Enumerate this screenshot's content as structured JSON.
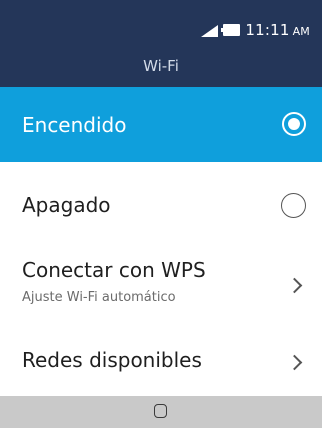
{
  "status_bar": {
    "time": "11:11",
    "ampm": "AM",
    "signal_icon": "signal-icon",
    "battery_icon": "battery-icon"
  },
  "header": {
    "title": "Wi-Fi"
  },
  "options": {
    "on": {
      "label": "Encendido",
      "selected": true
    },
    "off": {
      "label": "Apagado",
      "selected": false
    }
  },
  "items": {
    "wps": {
      "label": "Conectar con WPS",
      "subtitle": "Ajuste Wi-Fi automático"
    },
    "networks": {
      "label": "Redes disponibles"
    }
  },
  "colors": {
    "header_bg": "#243659",
    "selected_bg": "#0f9fdc",
    "navbar_bg": "#c9c9c9"
  }
}
